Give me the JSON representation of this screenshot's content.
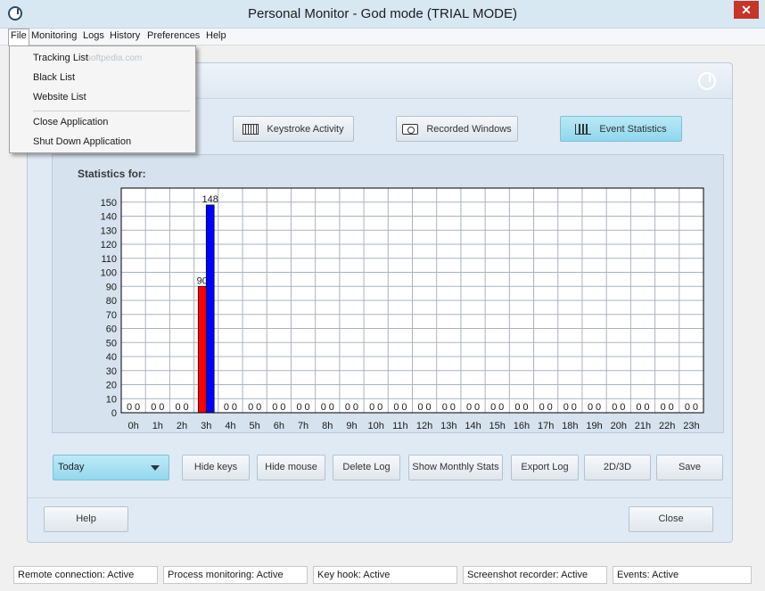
{
  "window": {
    "title": "Personal Monitor - God mode (TRIAL MODE)",
    "close_glyph": "✕"
  },
  "menu": [
    "File",
    "Monitoring",
    "Logs",
    "History",
    "Preferences",
    "Help"
  ],
  "file_menu": {
    "items": [
      "Tracking List",
      "Black List",
      "Website List",
      "Close Application",
      "Shut Down Application"
    ],
    "watermark": "softpedia.com"
  },
  "tabs": [
    {
      "label": "Keystroke Activity",
      "icon": "keyboard-icon"
    },
    {
      "label": "Recorded Windows",
      "icon": "camera-icon"
    },
    {
      "label": "Event Statistics",
      "icon": "bar-chart-icon",
      "active": true
    }
  ],
  "stats_label": "Statistics for:",
  "chart_data": {
    "type": "bar",
    "categories": [
      "0h",
      "1h",
      "2h",
      "3h",
      "4h",
      "5h",
      "6h",
      "7h",
      "8h",
      "9h",
      "10h",
      "11h",
      "12h",
      "13h",
      "14h",
      "15h",
      "16h",
      "17h",
      "18h",
      "19h",
      "20h",
      "21h",
      "22h",
      "23h"
    ],
    "series": [
      {
        "color": "#ff0000",
        "values": [
          0,
          0,
          0,
          90,
          0,
          0,
          0,
          0,
          0,
          0,
          0,
          0,
          0,
          0,
          0,
          0,
          0,
          0,
          0,
          0,
          0,
          0,
          0,
          0
        ]
      },
      {
        "color": "#0000ff",
        "values": [
          0,
          0,
          0,
          148,
          0,
          0,
          0,
          0,
          0,
          0,
          0,
          0,
          0,
          0,
          0,
          0,
          0,
          0,
          0,
          0,
          0,
          0,
          0,
          0
        ]
      }
    ],
    "ylim": [
      0,
      160
    ],
    "yticks": [
      0,
      10,
      20,
      30,
      40,
      50,
      60,
      70,
      80,
      90,
      100,
      110,
      120,
      130,
      140,
      150
    ],
    "grid": true,
    "data_labels": true
  },
  "controls": {
    "period": "Today",
    "hide_keys": "Hide keys",
    "hide_mouse": "Hide mouse",
    "delete_log": "Delete Log",
    "show_monthly": "Show Monthly Stats",
    "export_log": "Export Log",
    "view_mode": "2D/3D",
    "save": "Save"
  },
  "footer": {
    "help": "Help",
    "close": "Close"
  },
  "status": [
    "Remote connection: Active",
    "Process monitoring: Active",
    "Key hook: Active",
    "Screenshot recorder: Active",
    "Events: Active"
  ]
}
